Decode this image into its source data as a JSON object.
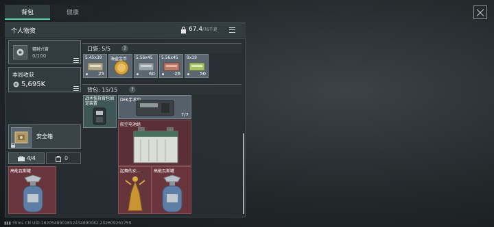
{
  "tabs": [
    {
      "label": "背包"
    },
    {
      "label": "健康"
    }
  ],
  "personal": {
    "title": "个人物资",
    "weight_value": "67.4",
    "weight_max": "/76千克",
    "radiation_label": "辐射兴奋",
    "radiation_value": "0/100",
    "earnings_label": "本局收获",
    "earnings_value": "5,695K",
    "safe_box_label": "安全箱",
    "loadout_left": "4/4",
    "loadout_right": "0"
  },
  "pocket": {
    "title": "口袋: 5/5",
    "help": "?",
    "items": [
      {
        "label": "5.45x39",
        "count": "25",
        "color": "#5c6f7c"
      },
      {
        "label": "海盗金币",
        "count": "",
        "color": "#556570"
      },
      {
        "label": "5.56x45",
        "count": "60",
        "color": "#5b6873"
      },
      {
        "label": "5.56x45",
        "count": "26",
        "color": "#5a6772"
      },
      {
        "label": "9x19",
        "count": "50",
        "color": "#586873"
      }
    ]
  },
  "backpack": {
    "title": "背包: 15/15",
    "help": "?",
    "items": [
      {
        "label": "战术快拆背包固定装置",
        "count": "",
        "color": "#3f5657"
      },
      {
        "label": "DEK手术包",
        "count": "7/7",
        "color": "#56606a"
      },
      {
        "label": "航空电池组",
        "count": "",
        "color": "#5b2f36"
      },
      {
        "label": "起舞的女...",
        "count": "",
        "color": "#66353c"
      },
      {
        "label": "高能瓦斯罐",
        "count": "",
        "color": "#6a343c"
      }
    ]
  },
  "safe_box_item": {
    "label": "高能瓦斯罐",
    "color": "#6a343c"
  },
  "status": {
    "ping": "35ms",
    "uid": "CN UID:1620548901852434890082,202609261759"
  },
  "colors": {
    "accent": "#56d7a8",
    "red_item": "#6a343c"
  }
}
